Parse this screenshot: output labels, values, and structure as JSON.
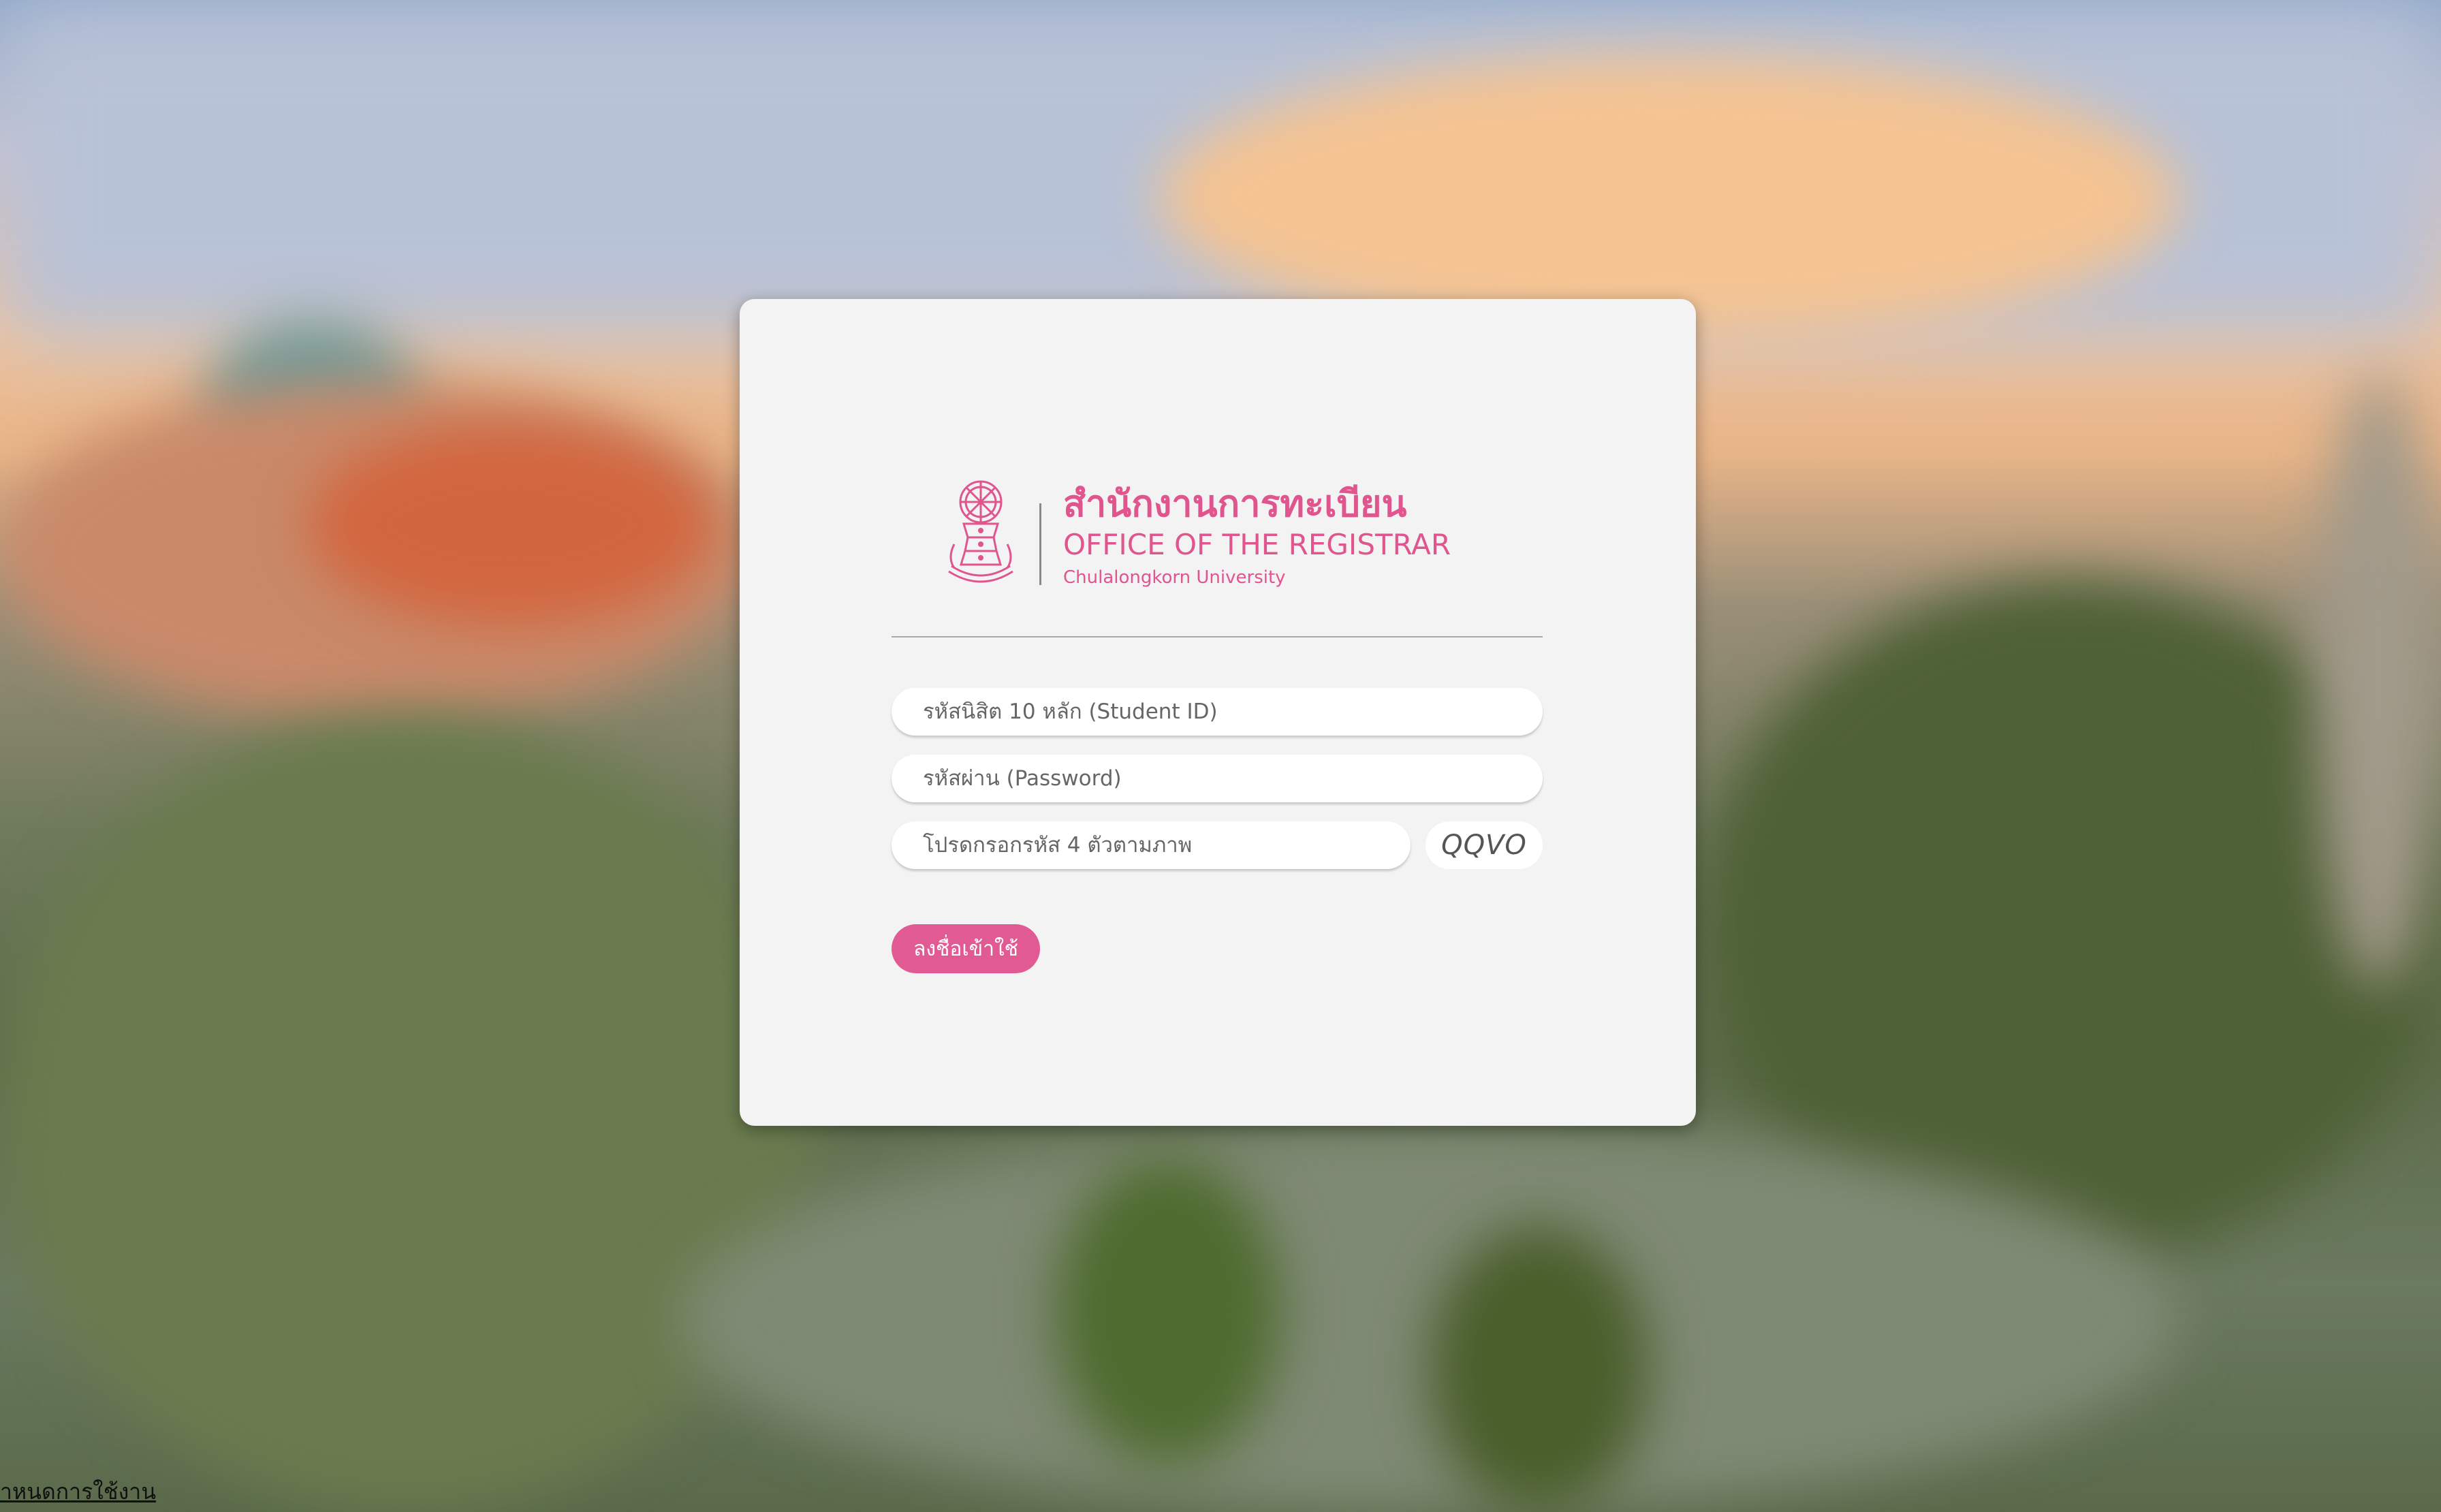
{
  "logo": {
    "thai_title": "สำนักงานการทะเบียน",
    "english_title": "OFFICE OF THE REGISTRAR",
    "university": "Chulalongkorn University"
  },
  "form": {
    "student_id_placeholder": "รหัสนิสิต 10 หลัก (Student ID)",
    "password_placeholder": "รหัสผ่าน (Password)",
    "captcha_placeholder": "โปรดกรอกรหัส 4 ตัวตามภาพ",
    "captcha_code": "QQVO",
    "login_label": "ลงชื่อเข้าใช้"
  },
  "footer": {
    "terms_link": "ำหนดการใช้งาน"
  },
  "colors": {
    "brand_pink": "#e0558e",
    "card_bg": "#f3f3f3"
  }
}
